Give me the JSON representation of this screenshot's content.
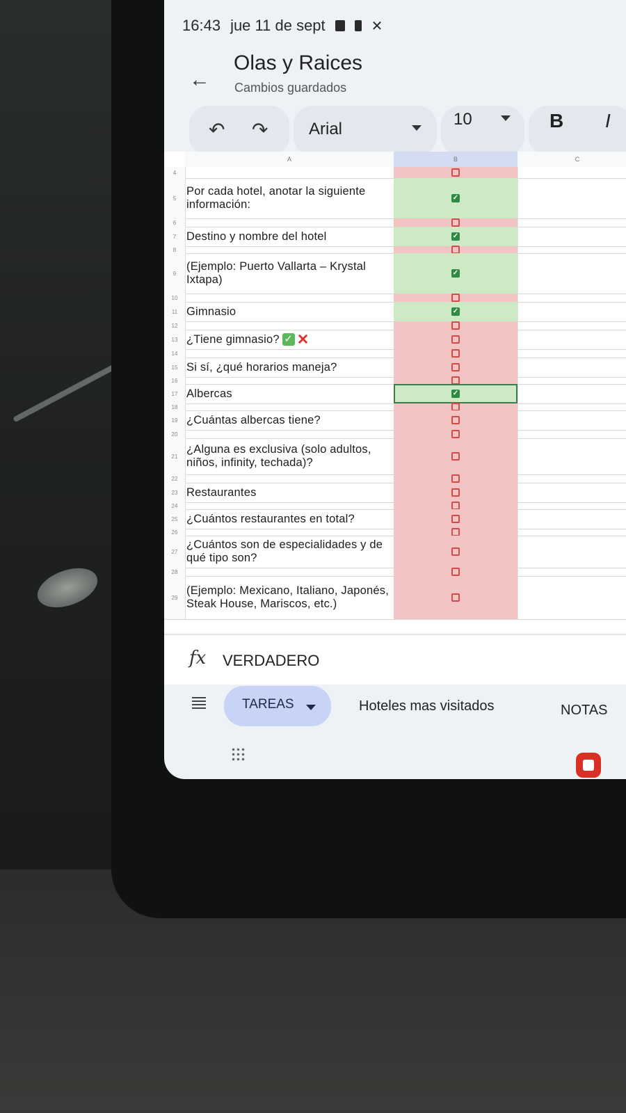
{
  "status_bar": {
    "time": "16:43",
    "date": "jue 11 de sept"
  },
  "document": {
    "title": "Olas y Raices",
    "save_status": "Cambios guardados"
  },
  "toolbar": {
    "font_name": "Arial",
    "font_size": "10",
    "bold_label": "B",
    "italic_label": "I"
  },
  "columns": [
    "A",
    "B",
    "C"
  ],
  "rows": [
    {
      "num": "4",
      "text": "",
      "checked": false
    },
    {
      "num": "5",
      "text": "Por cada hotel, anotar la siguiente información:",
      "checked": true
    },
    {
      "num": "6",
      "text": "",
      "checked": false
    },
    {
      "num": "7",
      "text": "Destino y nombre del hotel",
      "checked": true
    },
    {
      "num": "8",
      "text": "",
      "checked": false
    },
    {
      "num": "9",
      "text": "(Ejemplo: Puerto Vallarta – Krystal Ixtapa)",
      "checked": true
    },
    {
      "num": "10",
      "text": "",
      "checked": false
    },
    {
      "num": "11",
      "text": "Gimnasio",
      "checked": true
    },
    {
      "num": "12",
      "text": "",
      "checked": false
    },
    {
      "num": "13",
      "text": "¿Tiene gimnasio?",
      "checked": false
    },
    {
      "num": "14",
      "text": "",
      "checked": false
    },
    {
      "num": "15",
      "text": "Si sí, ¿qué horarios maneja?",
      "checked": false
    },
    {
      "num": "16",
      "text": "",
      "checked": false
    },
    {
      "num": "17",
      "text": "Albercas",
      "checked": true
    },
    {
      "num": "18",
      "text": "",
      "checked": false
    },
    {
      "num": "19",
      "text": "¿Cuántas albercas tiene?",
      "checked": false
    },
    {
      "num": "20",
      "text": "",
      "checked": false
    },
    {
      "num": "21",
      "text": "¿Alguna es exclusiva (solo adultos, niños, infinity, techada)?",
      "checked": false
    },
    {
      "num": "22",
      "text": "",
      "checked": false
    },
    {
      "num": "23",
      "text": "Restaurantes",
      "checked": false
    },
    {
      "num": "24",
      "text": "",
      "checked": false
    },
    {
      "num": "25",
      "text": "¿Cuántos restaurantes en total?",
      "checked": false
    },
    {
      "num": "26",
      "text": "",
      "checked": false
    },
    {
      "num": "27",
      "text": "¿Cuántos son de especialidades y de qué tipo son?",
      "checked": false
    },
    {
      "num": "28",
      "text": "",
      "checked": false
    },
    {
      "num": "29",
      "text": "(Ejemplo: Mexicano, Italiano, Japonés, Steak House, Mariscos, etc.)",
      "checked": false
    }
  ],
  "selected_row": "17",
  "formula_bar": {
    "fx_label": "fx",
    "value": "VERDADERO"
  },
  "sheet_tabs": {
    "active": "TAREAS",
    "others": [
      "Hoteles mas visitados",
      "NOTAS"
    ]
  },
  "colors": {
    "checked_fill": "#cde9c5",
    "unchecked_fill": "#f2c4c4",
    "active_tab": "#c7d4f5"
  }
}
